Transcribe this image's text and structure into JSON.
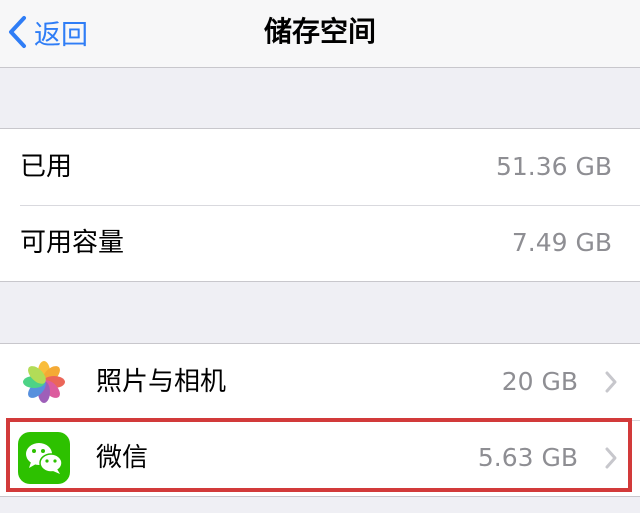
{
  "navbar": {
    "back_label": "返回",
    "title": "储存空间"
  },
  "storage": [
    {
      "label": "已用",
      "value": "51.36 GB"
    },
    {
      "label": "可用容量",
      "value": "7.49 GB"
    }
  ],
  "apps": [
    {
      "name": "照片与相机",
      "size": "20 GB",
      "icon": "photos-icon"
    },
    {
      "name": "微信",
      "size": "5.63 GB",
      "icon": "wechat-icon"
    }
  ],
  "colors": {
    "accent": "#2f7df6",
    "highlight": "#d23a3a",
    "wechat_green": "#2dc100"
  }
}
